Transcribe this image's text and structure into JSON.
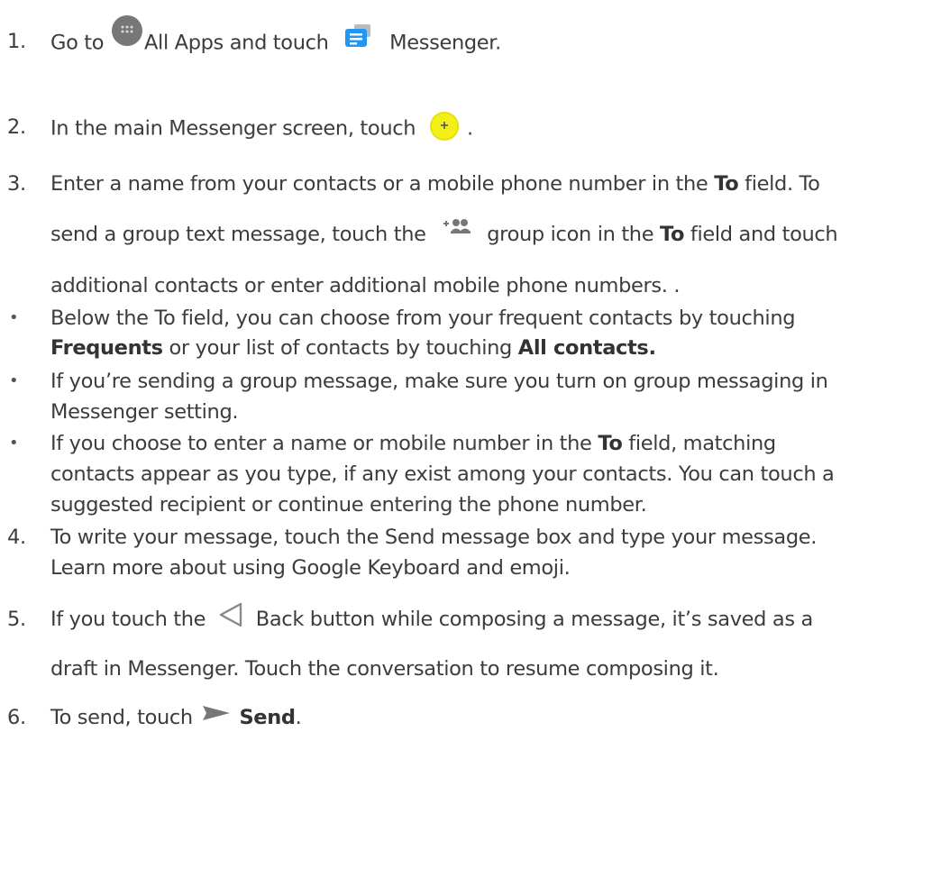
{
  "steps": [
    {
      "number": "1.",
      "lines": [
        [
          {
            "t": "Go to "
          },
          {
            "icon": "all-apps-icon"
          },
          {
            "t": "All Apps and touch "
          },
          {
            "icon": "messenger-app-icon"
          },
          {
            "t": " Messenger."
          }
        ]
      ]
    },
    {
      "number": "2.",
      "lines": [
        [
          {
            "t": "In the main Messenger screen, touch "
          },
          {
            "icon": "new-message-fab-icon"
          },
          {
            "t": "."
          }
        ]
      ]
    },
    {
      "number": "3.",
      "lines": [
        [
          {
            "t": "Enter a name from your contacts or a mobile phone number in the "
          },
          {
            "b": "To"
          },
          {
            "t": " field. To"
          }
        ],
        [
          {
            "t": "send a group text message, touch the "
          },
          {
            "icon": "add-group-icon"
          },
          {
            "t": " group icon in the "
          },
          {
            "b": "To"
          },
          {
            "t": " field and touch"
          }
        ],
        [
          {
            "t": "additional contacts or enter additional mobile phone numbers. ."
          }
        ]
      ]
    }
  ],
  "bullets": [
    {
      "marker": "•",
      "lines": [
        [
          {
            "t": "Below the To field, you can choose from your frequent contacts by touching"
          }
        ],
        [
          {
            "b": "Frequents"
          },
          {
            "t": " or your list of contacts by touching "
          },
          {
            "b": "All contacts."
          }
        ]
      ]
    },
    {
      "marker": "•",
      "lines": [
        [
          {
            "t": "If you’re sending a group message, make sure you turn on group messaging in"
          }
        ],
        [
          {
            "t": "Messenger setting."
          }
        ]
      ]
    },
    {
      "marker": "•",
      "lines": [
        [
          {
            "t": "If you choose to enter a name or mobile number in the "
          },
          {
            "b": "To"
          },
          {
            "t": " field, matching"
          }
        ],
        [
          {
            "t": "contacts appear as you type, if any exist among your contacts. You can touch a"
          }
        ],
        [
          {
            "t": "suggested recipient or continue entering the phone number."
          }
        ]
      ]
    }
  ],
  "steps_after": [
    {
      "number": "4.",
      "lines": [
        [
          {
            "t": "To write your message, touch the Send message box and type your message."
          }
        ],
        [
          {
            "t": "Learn more about using Google Keyboard and emoji."
          }
        ]
      ]
    },
    {
      "number": "5.",
      "lines": [
        [
          {
            "t": "If you touch the "
          },
          {
            "icon": "back-button-icon"
          },
          {
            "t": " Back button while composing a message, it’s saved as a"
          }
        ],
        [
          {
            "t": "draft in Messenger. Touch the conversation to resume composing it."
          }
        ]
      ]
    },
    {
      "number": "6.",
      "lines": [
        [
          {
            "t": "To send, touch "
          },
          {
            "icon": "send-icon"
          },
          {
            "t": " "
          },
          {
            "b": "Send"
          },
          {
            "t": "."
          }
        ]
      ]
    }
  ]
}
